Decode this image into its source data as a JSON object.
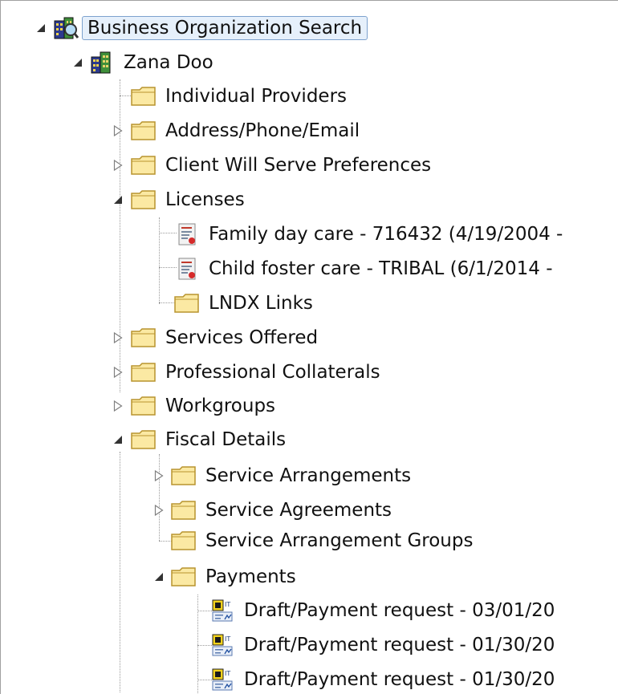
{
  "tree": {
    "root": {
      "label": "Business Organization Search",
      "icon": "search-building-icon"
    },
    "org": {
      "label": "Zana Doo",
      "icon": "building-icon"
    },
    "items": [
      {
        "label": "Individual Providers",
        "icon": "folder-icon"
      },
      {
        "label": "Address/Phone/Email",
        "icon": "folder-icon"
      },
      {
        "label": "Client Will Serve Preferences",
        "icon": "folder-icon"
      },
      {
        "label": "Licenses",
        "icon": "folder-icon"
      },
      {
        "label": "Family day care - 716432 (4/19/2004 -",
        "icon": "license-certificate-icon"
      },
      {
        "label": "Child foster care - TRIBAL (6/1/2014 -",
        "icon": "license-certificate-icon"
      },
      {
        "label": "LNDX Links",
        "icon": "folder-icon"
      },
      {
        "label": "Services Offered",
        "icon": "folder-icon"
      },
      {
        "label": "Professional Collaterals",
        "icon": "folder-icon"
      },
      {
        "label": "Workgroups",
        "icon": "folder-icon"
      },
      {
        "label": "Fiscal Details",
        "icon": "folder-icon"
      },
      {
        "label": "Service Arrangements",
        "icon": "folder-icon"
      },
      {
        "label": "Service Agreements",
        "icon": "folder-icon"
      },
      {
        "label": "Service Arrangement Groups",
        "icon": "folder-icon"
      },
      {
        "label": "Payments",
        "icon": "folder-icon"
      },
      {
        "label": "Draft/Payment request - 03/01/20",
        "icon": "payment-request-icon"
      },
      {
        "label": "Draft/Payment request - 01/30/20",
        "icon": "payment-request-icon"
      },
      {
        "label": "Draft/Payment request - 01/30/20",
        "icon": "payment-request-icon"
      }
    ]
  },
  "colors": {
    "folder_fill": "#fbe9a3",
    "folder_stroke": "#b8942e",
    "selection_bg": "#e6f0fb",
    "selection_border": "#7da2ce"
  }
}
